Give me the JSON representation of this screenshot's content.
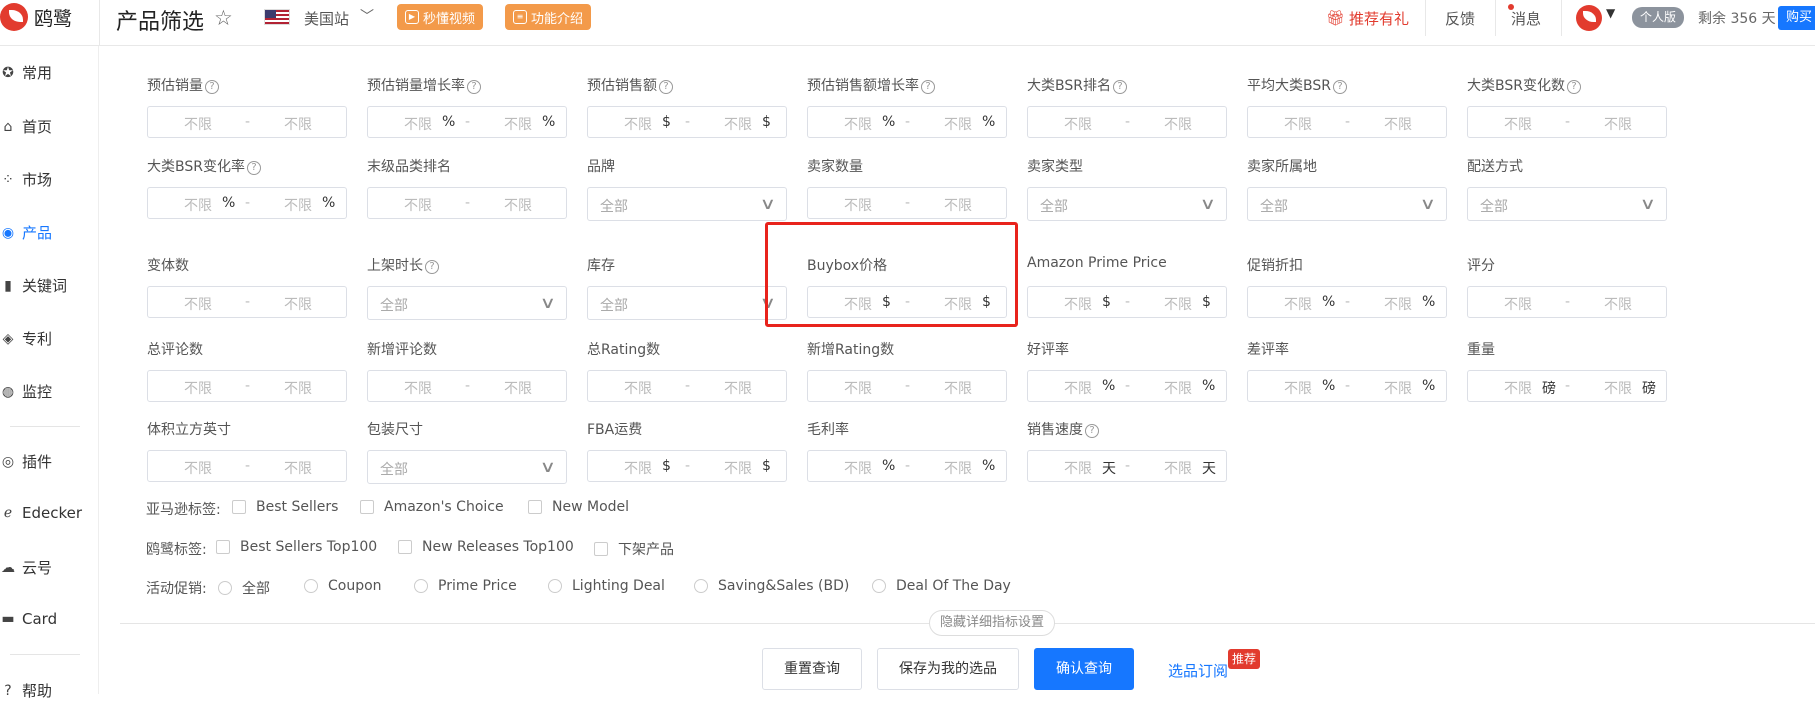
{
  "app": {
    "logo_text": "鸥鹭",
    "page_title": "产品筛选",
    "site": "美国站",
    "video_btn": "秒懂视频",
    "intro_btn": "功能介绍",
    "recommend": "推荐有礼",
    "feedback": "反馈",
    "messages": "消息",
    "version": "个人版",
    "remaining": "剩余 356 天",
    "buy": "购买"
  },
  "sidebar": [
    {
      "label": "常用",
      "icon": "star-icon"
    },
    {
      "label": "首页",
      "icon": "home-icon"
    },
    {
      "label": "市场",
      "icon": "grid-icon"
    },
    {
      "label": "产品",
      "icon": "eye-icon"
    },
    {
      "label": "关键词",
      "icon": "bar-chart-icon"
    },
    {
      "label": "专利",
      "icon": "shield-icon"
    },
    {
      "label": "监控",
      "icon": "monitor-icon"
    },
    {
      "label": "插件",
      "icon": "chrome-icon"
    },
    {
      "label": "Edecker",
      "icon": "edecker-icon"
    },
    {
      "label": "云号",
      "icon": "cloud-icon"
    },
    {
      "label": "Card",
      "icon": "card-icon"
    },
    {
      "label": "帮助",
      "icon": "help-icon"
    }
  ],
  "placeholder": "不限",
  "select_default": "全部",
  "filters": [
    {
      "label": "预估销量",
      "help": true,
      "type": "range",
      "unit": ""
    },
    {
      "label": "预估销量增长率",
      "help": true,
      "type": "range",
      "unit": "%"
    },
    {
      "label": "预估销售额",
      "help": true,
      "type": "range",
      "unit": "$"
    },
    {
      "label": "预估销售额增长率",
      "help": true,
      "type": "range",
      "unit": "%"
    },
    {
      "label": "大类BSR排名",
      "help": true,
      "type": "range",
      "unit": ""
    },
    {
      "label": "平均大类BSR",
      "help": true,
      "type": "range",
      "unit": ""
    },
    {
      "label": "大类BSR变化数",
      "help": true,
      "type": "range",
      "unit": ""
    },
    {
      "label": "大类BSR变化率",
      "help": true,
      "type": "range",
      "unit": "%"
    },
    {
      "label": "末级品类排名",
      "help": false,
      "type": "range",
      "unit": ""
    },
    {
      "label": "品牌",
      "help": false,
      "type": "select"
    },
    {
      "label": "卖家数量",
      "help": false,
      "type": "range",
      "unit": ""
    },
    {
      "label": "卖家类型",
      "help": false,
      "type": "select"
    },
    {
      "label": "卖家所属地",
      "help": false,
      "type": "select"
    },
    {
      "label": "配送方式",
      "help": false,
      "type": "select"
    },
    {
      "label": "变体数",
      "help": false,
      "type": "range",
      "unit": ""
    },
    {
      "label": "上架时长",
      "help": true,
      "type": "select"
    },
    {
      "label": "库存",
      "help": false,
      "type": "select"
    },
    {
      "label": "Buybox价格",
      "help": false,
      "type": "range",
      "unit": "$"
    },
    {
      "label": "Amazon Prime Price",
      "help": false,
      "type": "range",
      "unit": "$"
    },
    {
      "label": "促销折扣",
      "help": false,
      "type": "range",
      "unit": "%"
    },
    {
      "label": "评分",
      "help": false,
      "type": "range",
      "unit": ""
    },
    {
      "label": "总评论数",
      "help": false,
      "type": "range",
      "unit": ""
    },
    {
      "label": "新增评论数",
      "help": false,
      "type": "range",
      "unit": ""
    },
    {
      "label": "总Rating数",
      "help": false,
      "type": "range",
      "unit": ""
    },
    {
      "label": "新增Rating数",
      "help": false,
      "type": "range",
      "unit": ""
    },
    {
      "label": "好评率",
      "help": false,
      "type": "range",
      "unit": "%"
    },
    {
      "label": "差评率",
      "help": false,
      "type": "range",
      "unit": "%"
    },
    {
      "label": "重量",
      "help": false,
      "type": "range",
      "unit": "磅"
    },
    {
      "label": "体积立方英寸",
      "help": false,
      "type": "range",
      "unit": ""
    },
    {
      "label": "包装尺寸",
      "help": false,
      "type": "select"
    },
    {
      "label": "FBA运费",
      "help": false,
      "type": "range",
      "unit": "$"
    },
    {
      "label": "毛利率",
      "help": false,
      "type": "range",
      "unit": "%"
    },
    {
      "label": "销售速度",
      "help": true,
      "type": "range",
      "unit": "天"
    }
  ],
  "amazon_tags": {
    "label": "亚马逊标签:",
    "options": [
      "Best Sellers",
      "Amazon's Choice",
      "New Model"
    ]
  },
  "oulu_tags": {
    "label": "鸥鹭标签:",
    "options": [
      "Best Sellers Top100",
      "New Releases Top100",
      "下架产品"
    ]
  },
  "promotions": {
    "label": "活动促销:",
    "options": [
      "全部",
      "Coupon",
      "Prime Price",
      "Lighting Deal",
      "Saving&Sales (BD)",
      "Deal Of The Day"
    ]
  },
  "footer": {
    "hide_settings": "隐藏详细指标设置",
    "reset": "重置查询",
    "save": "保存为我的选品",
    "confirm": "确认查询",
    "subscribe": "选品订阅",
    "recommend_badge": "推荐"
  }
}
